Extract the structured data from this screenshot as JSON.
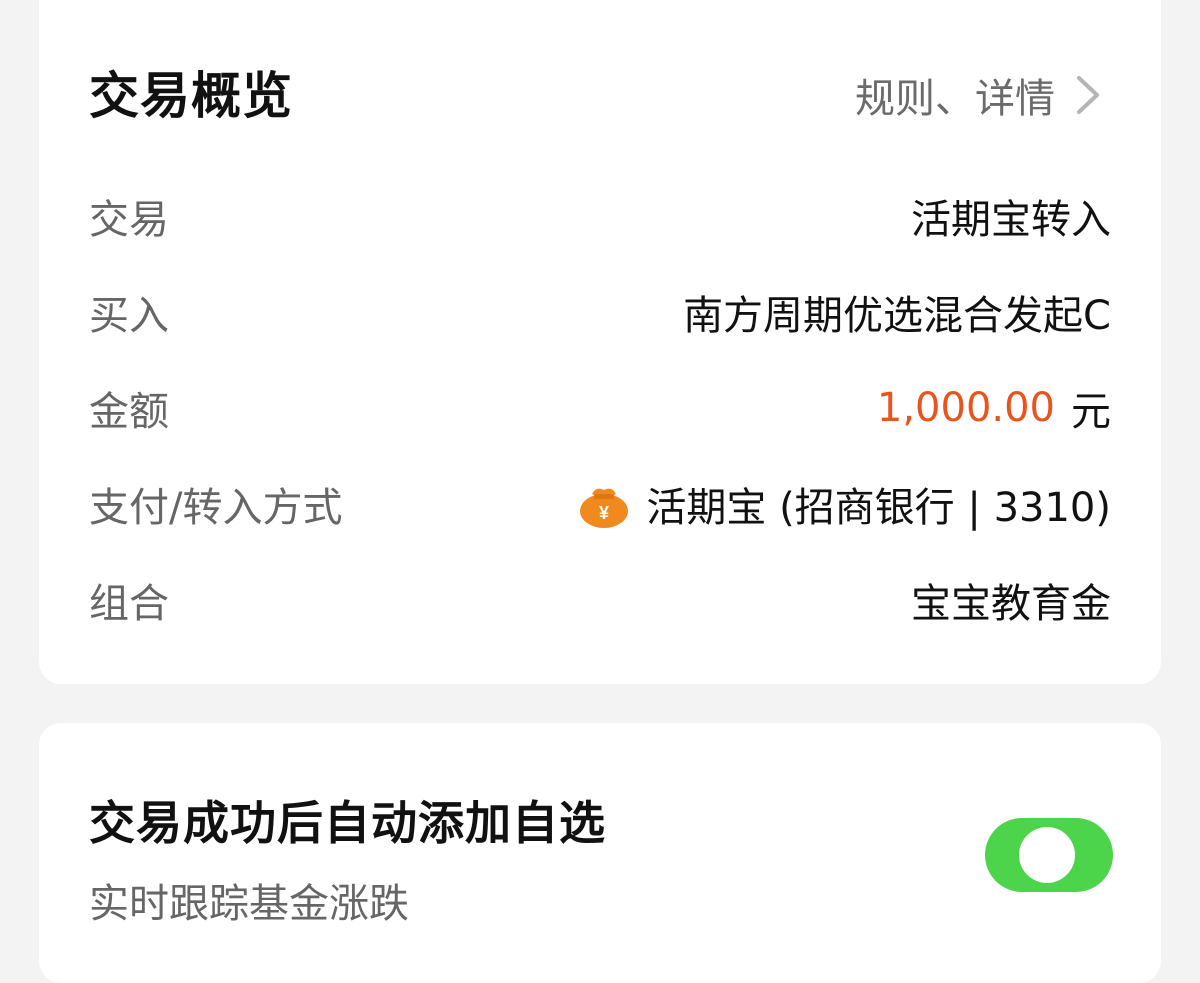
{
  "overview": {
    "title": "交易概览",
    "rules_link": "规则、详情",
    "rows": [
      {
        "label": "交易",
        "value": "活期宝转入"
      },
      {
        "label": "买入",
        "value": "南方周期优选混合发起C"
      },
      {
        "label": "金额",
        "amount": "1,000.00",
        "unit": "元"
      },
      {
        "label": "支付/转入方式",
        "value": "活期宝 (招商银行 | 3310)",
        "icon": "money-bag-icon"
      },
      {
        "label": "组合",
        "value": "宝宝教育金"
      }
    ]
  },
  "auto_add": {
    "title": "交易成功后自动添加自选",
    "subtitle": "实时跟踪基金涨跌",
    "toggle_on": true
  },
  "colors": {
    "accent_amount": "#e8541f",
    "toggle_on": "#4cd44a",
    "icon_orange": "#f08a1e"
  }
}
